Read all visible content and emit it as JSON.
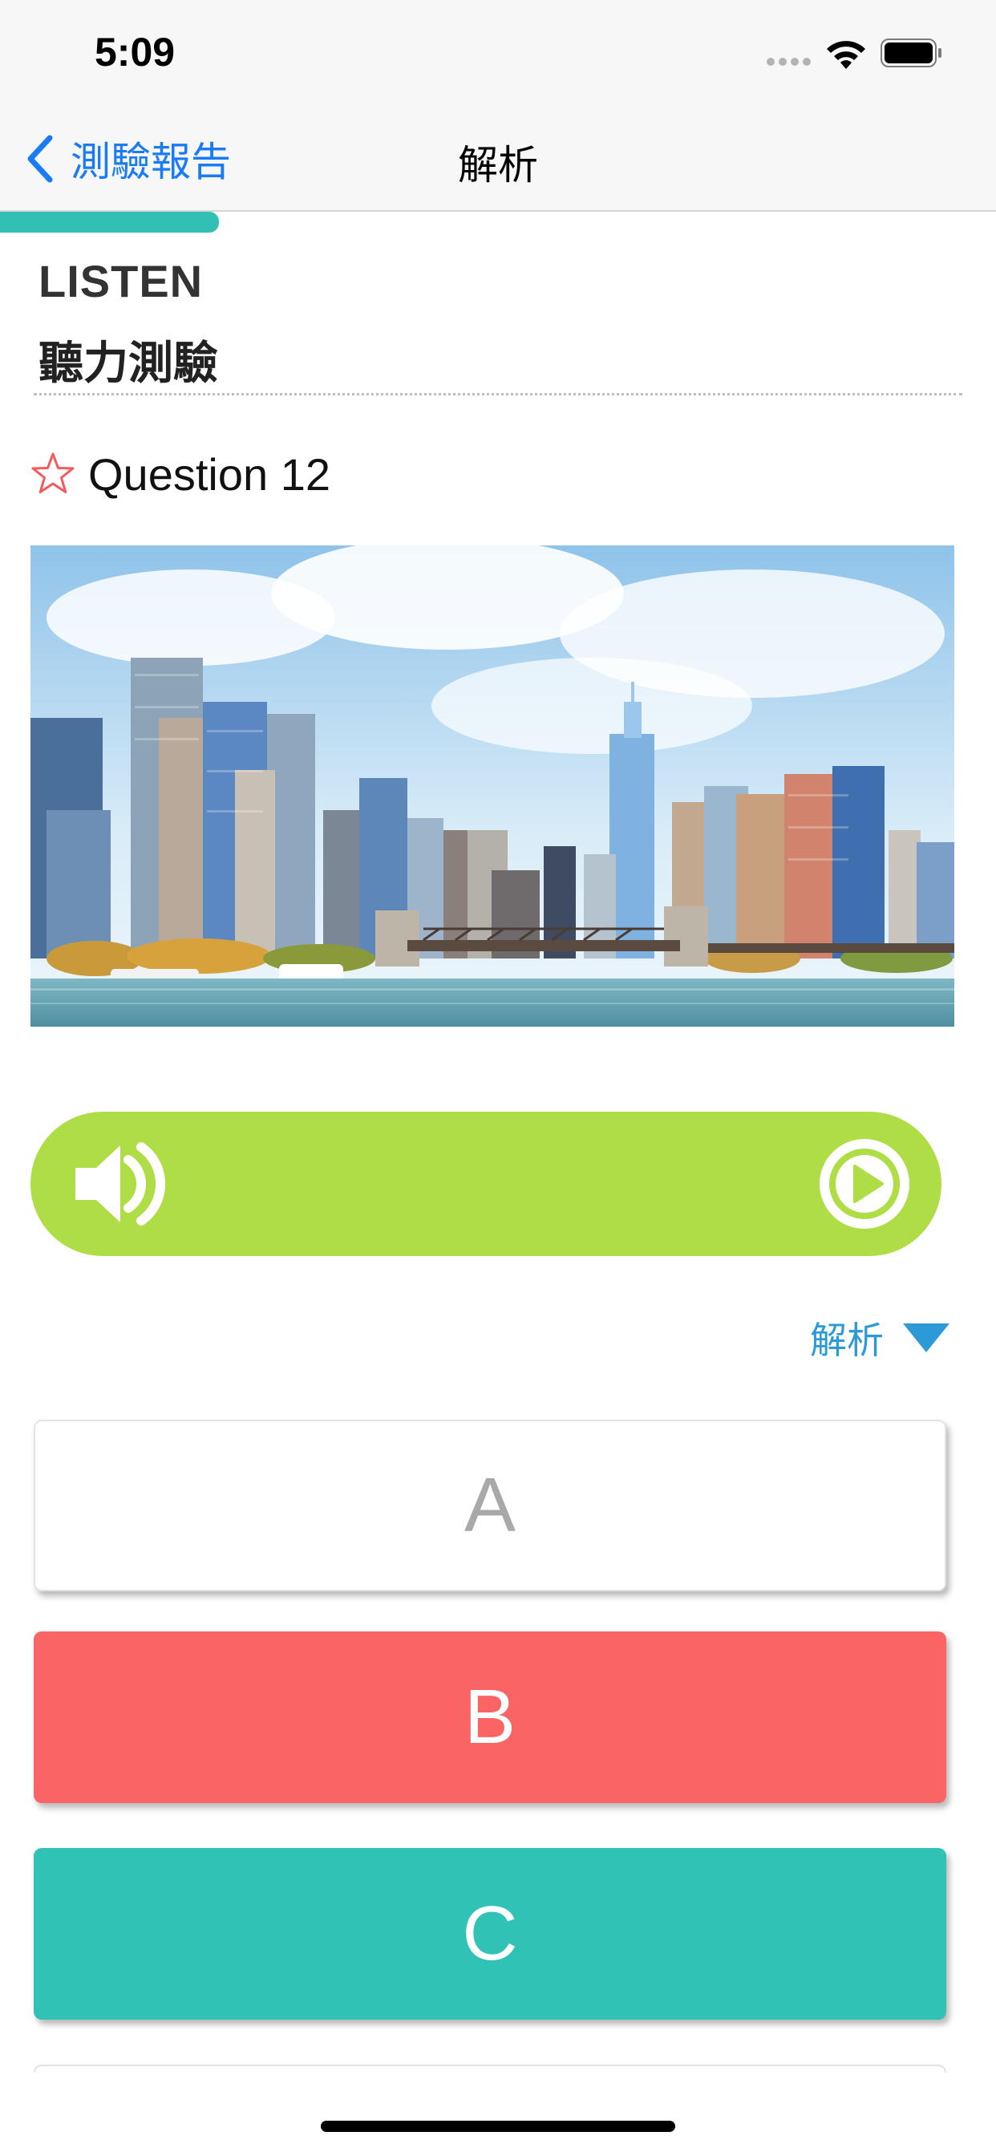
{
  "status_bar": {
    "time": "5:09",
    "icons": [
      "signal-dots-icon",
      "wifi-icon",
      "battery-icon"
    ]
  },
  "nav": {
    "back_label": "測驗報告",
    "title": "解析",
    "accent_color": "#1a7cf5"
  },
  "progress": {
    "fraction": 0.22,
    "color": "#31c0b3"
  },
  "section": {
    "title": "LISTEN",
    "subtitle": "聽力測驗"
  },
  "question": {
    "label": "Question 12",
    "star_icon": "star-outline-icon",
    "image_icon": "city-skyline-photo"
  },
  "audio": {
    "speaker_icon": "speaker-icon",
    "play_icon": "play-icon",
    "bar_color": "#aedd45"
  },
  "explanation": {
    "label": "解析",
    "arrow_icon": "triangle-down-icon"
  },
  "options": [
    {
      "label": "A",
      "state": "neutral",
      "color": "#ffffff"
    },
    {
      "label": "B",
      "state": "wrong",
      "color": "#fa6464"
    },
    {
      "label": "C",
      "state": "correct",
      "color": "#31c2b6"
    }
  ]
}
